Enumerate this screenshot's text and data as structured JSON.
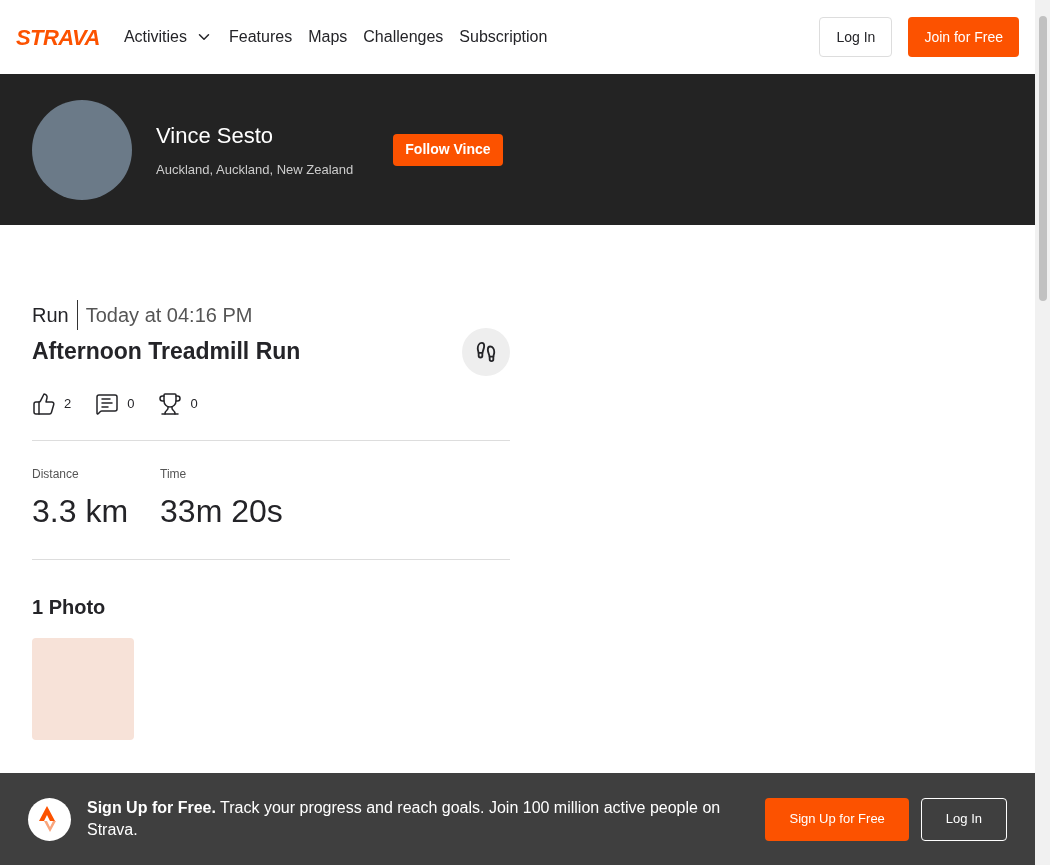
{
  "nav": {
    "logo": "STRAVA",
    "items": [
      {
        "label": "Activities",
        "dropdown": true
      },
      {
        "label": "Features",
        "dropdown": false
      },
      {
        "label": "Maps",
        "dropdown": false
      },
      {
        "label": "Challenges",
        "dropdown": false
      },
      {
        "label": "Subscription",
        "dropdown": false
      }
    ],
    "login": "Log In",
    "join": "Join for Free"
  },
  "profile": {
    "name": "Vince Sesto",
    "location": "Auckland, Auckland, New Zealand",
    "follow": "Follow Vince"
  },
  "activity": {
    "sport": "Run",
    "time": "Today at 04:16 PM",
    "title": "Afternoon Treadmill Run",
    "kudos": "2",
    "comments": "0",
    "achievements": "0",
    "stats": [
      {
        "label": "Distance",
        "value": "3.3 km"
      },
      {
        "label": "Time",
        "value": "33m 20s"
      }
    ],
    "photos_heading": "1 Photo"
  },
  "banner": {
    "bold": "Sign Up for Free.",
    "text": "Track your progress and reach goals. Join 100 million active people on Strava.",
    "signup": "Sign Up for Free",
    "login": "Log In"
  }
}
